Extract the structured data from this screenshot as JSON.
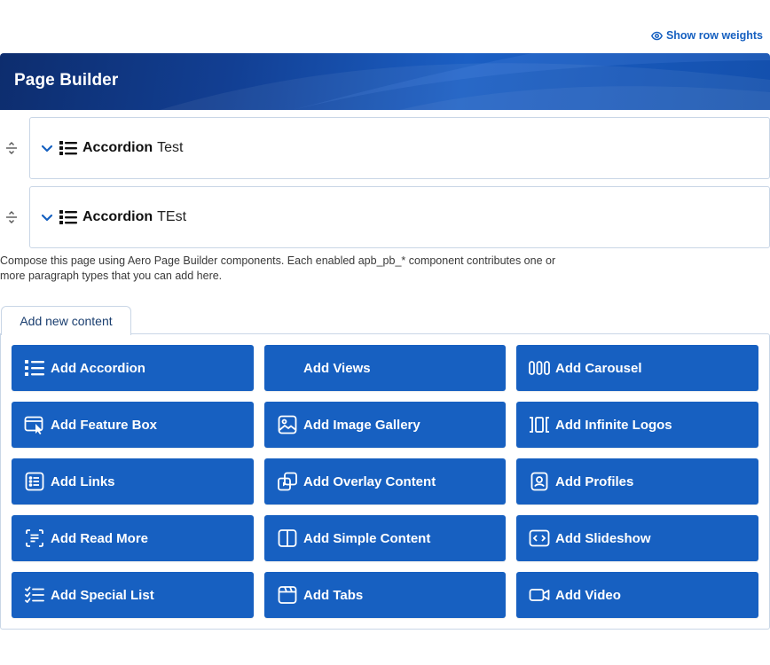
{
  "header": {
    "row_weights_label": "Show row weights",
    "row_weights_icon": "eye-icon"
  },
  "banner": {
    "title": "Page Builder"
  },
  "rows": [
    {
      "type": "Accordion",
      "title": "Test",
      "icon": "list-icon"
    },
    {
      "type": "Accordion",
      "title": "TEst",
      "icon": "list-icon"
    }
  ],
  "help_text": "Compose this page using Aero Page Builder components. Each enabled apb_pb_* component contributes one or more paragraph types that you can add here.",
  "tab": {
    "label": "Add new content"
  },
  "add_buttons": [
    {
      "label": "Add Accordion",
      "icon": "list-icon"
    },
    {
      "label": "Add Views",
      "icon": ""
    },
    {
      "label": "Add Carousel",
      "icon": "carousel-icon"
    },
    {
      "label": "Add Feature Box",
      "icon": "feature-box-icon"
    },
    {
      "label": "Add Image Gallery",
      "icon": "image-icon"
    },
    {
      "label": "Add Infinite Logos",
      "icon": "infinite-logos-icon"
    },
    {
      "label": "Add Links",
      "icon": "links-icon"
    },
    {
      "label": "Add Overlay Content",
      "icon": "overlay-icon"
    },
    {
      "label": "Add Profiles",
      "icon": "profile-icon"
    },
    {
      "label": "Add Read More",
      "icon": "read-more-icon"
    },
    {
      "label": "Add Simple Content",
      "icon": "simple-content-icon"
    },
    {
      "label": "Add Slideshow",
      "icon": "slideshow-icon"
    },
    {
      "label": "Add Special List",
      "icon": "checklist-icon"
    },
    {
      "label": "Add Tabs",
      "icon": "tabs-icon"
    },
    {
      "label": "Add Video",
      "icon": "video-icon"
    }
  ],
  "colors": {
    "accent": "#1760c1",
    "banner_dark": "#0d2d6e",
    "link": "#1660c0",
    "border": "#c9d6e6"
  }
}
